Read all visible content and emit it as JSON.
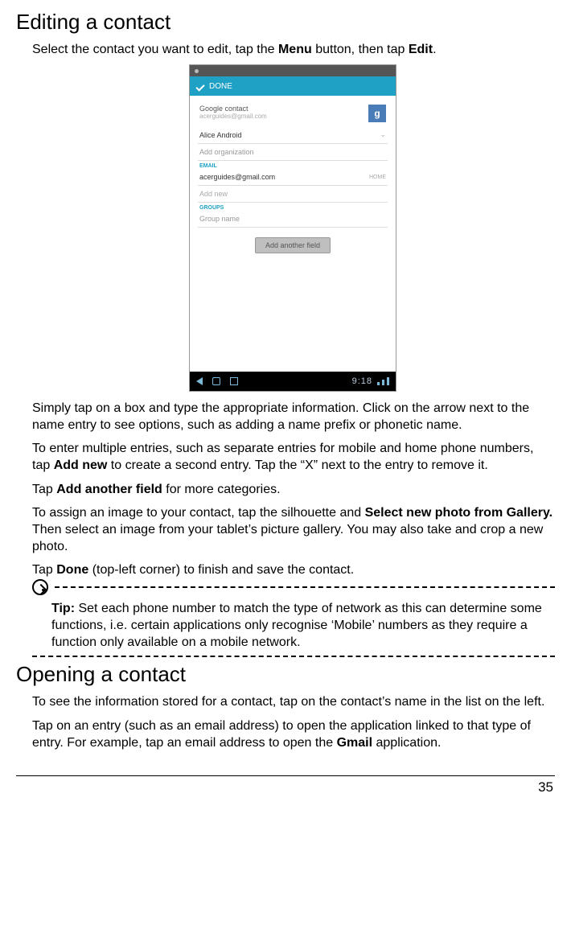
{
  "section1": {
    "title": "Editing a contact",
    "intro_1": "Select the contact you want to edit, tap the ",
    "intro_b1": "Menu",
    "intro_2": " button, then tap ",
    "intro_b2": "Edit",
    "intro_3": ".",
    "p2": "Simply tap on a box and type the appropriate information. Click on the arrow next to the name entry to see options, such as adding a name prefix or phonetic name.",
    "p3_1": "To enter multiple entries, such as separate entries for mobile and home phone numbers, tap ",
    "p3_b1": "Add new",
    "p3_2": " to create a second entry. Tap the “X” next to the entry to remove it.",
    "p4_1": "Tap ",
    "p4_b1": "Add another field",
    "p4_2": " for more categories.",
    "p5_1": "To assign an image to your contact, tap the silhouette and ",
    "p5_b1": "Select new photo from Gallery.",
    "p5_2": " Then select an image from your tablet’s picture gallery. You may also take and crop a new photo.",
    "p6_1": "Tap ",
    "p6_b1": "Done",
    "p6_2": " (top-left corner) to finish and save the contact.",
    "tip_b": "Tip:",
    "tip_txt": " Set each phone number to match the type of network as this can determine some functions, i.e. certain applications only recognise ‘Mobile’ numbers as they require a function only available on a mobile network."
  },
  "screenshot": {
    "done": "DONE",
    "gc_label": "Google contact",
    "gc_email": "acerguides@gmail.com",
    "name_value": "Alice Android",
    "org_placeholder": "Add organization",
    "email_header": "EMAIL",
    "email_value": "acerguides@gmail.com",
    "email_type": "HOME",
    "addnew": "Add new",
    "groups_header": "GROUPS",
    "group_placeholder": "Group name",
    "add_field": "Add another field",
    "avatar_letter": "g",
    "time": "9:18"
  },
  "section2": {
    "title": "Opening a contact",
    "p1": "To see the information stored for a contact, tap on the contact’s name in the list on the left.",
    "p2_1": "Tap on an entry (such as an email address) to open the application linked to that type of entry. For example, tap an email address to open the ",
    "p2_b1": "Gmail",
    "p2_2": " application."
  },
  "page_number": "35"
}
